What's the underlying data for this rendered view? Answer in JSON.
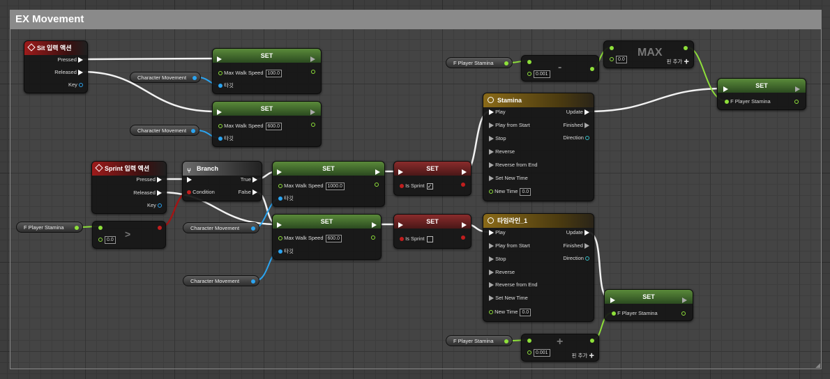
{
  "graph": {
    "comment_title": "EX Movement"
  },
  "nodes": {
    "sit": {
      "title": "Sit 입력 액션",
      "pressed": "Pressed",
      "released": "Released",
      "key": "Key"
    },
    "sprint": {
      "title": "Sprint 입력 액션",
      "pressed": "Pressed",
      "released": "Released",
      "key": "Key"
    },
    "branch": {
      "title": "Branch",
      "condition": "Condition",
      "true_label": "True",
      "false_label": "False"
    },
    "set1": {
      "title": "SET",
      "prop": "Max Walk Speed",
      "value": "100.0",
      "target": "타깃"
    },
    "set2": {
      "title": "SET",
      "prop": "Max Walk Speed",
      "value": "600.0",
      "target": "타깃"
    },
    "set3": {
      "title": "SET",
      "prop": "Max Walk Speed",
      "value": "1000.0",
      "target": "타깃"
    },
    "set4": {
      "title": "SET",
      "prop": "Max Walk Speed",
      "value": "600.0",
      "target": "타깃"
    },
    "set_sprint_true": {
      "title": "SET",
      "prop": "Is Sprint",
      "checked": "✓"
    },
    "set_sprint_false": {
      "title": "SET",
      "prop": "Is Sprint"
    },
    "set_stamina_top": {
      "title": "SET",
      "prop": "F Player Stamina"
    },
    "set_stamina_bottom": {
      "title": "SET",
      "prop": "F Player Stamina"
    },
    "timeline_stamina": {
      "title": "Stamina",
      "play": "Play",
      "play_from_start": "Play from Start",
      "stop": "Stop",
      "reverse": "Reverse",
      "reverse_from_end": "Reverse from End",
      "set_new_time": "Set New Time",
      "new_time": "New Time",
      "new_time_value": "0.0",
      "update": "Update",
      "finished": "Finished",
      "direction": "Direction"
    },
    "timeline_1": {
      "title": "타임라인_1",
      "play": "Play",
      "play_from_start": "Play from Start",
      "stop": "Stop",
      "reverse": "Reverse",
      "reverse_from_end": "Reverse from End",
      "set_new_time": "Set New Time",
      "new_time": "New Time",
      "new_time_value": "0.0",
      "update": "Update",
      "finished": "Finished",
      "direction": "Direction"
    },
    "max": {
      "title": "MAX",
      "value": "0.0",
      "add_pin": "핀 추가"
    },
    "minus": {
      "op": "-",
      "value": "0.001"
    },
    "plus": {
      "op": "+",
      "value": "0.001",
      "add_pin": "핀 추가"
    },
    "greater": {
      "op": ">",
      "value": "0.0"
    }
  },
  "getters": {
    "cm1": "Character Movement",
    "cm2": "Character Movement",
    "cm3": "Character Movement",
    "cm4": "Character Movement",
    "stamina_top": "F Player Stamina",
    "stamina_mid": "F Player Stamina",
    "stamina_bottom": "F Player Stamina"
  },
  "colors": {
    "exec": "#ffffff",
    "float": "#8ee03a",
    "object": "#2ba4f0",
    "bool": "#c01e1e",
    "input_event": "#9d1b1b",
    "timeline": "#8a6a18",
    "set": "#5a8a3a"
  }
}
